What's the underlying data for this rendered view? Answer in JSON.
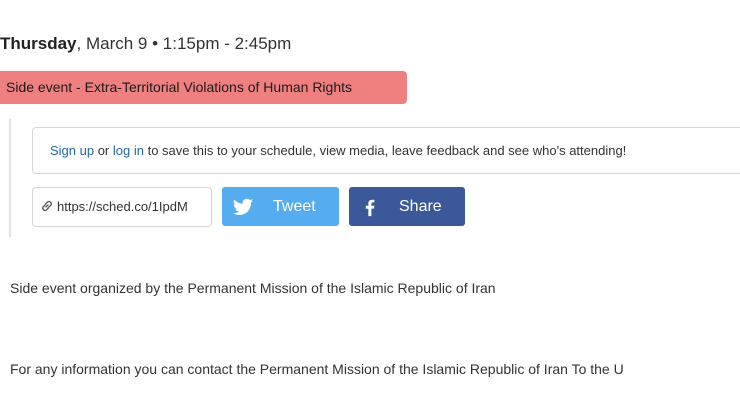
{
  "event": {
    "day": "Thursday",
    "date_time": ", March 9 • 1:15pm - 2:45pm",
    "type_label": "Side event - Extra-Territorial Violations of Human Rights"
  },
  "signup": {
    "signup_link": "Sign up",
    "or_text": " or ",
    "login_link": "log in",
    "rest_text": " to save this to your schedule, view media, leave feedback and see who's attending!"
  },
  "share": {
    "short_url": "https://sched.co/1IpdM",
    "tweet_label": "Tweet",
    "share_label": "Share",
    "icons": {
      "link": "link-icon",
      "twitter": "twitter-bird-icon",
      "facebook": "facebook-f-icon"
    },
    "colors": {
      "tweet": "#55acee",
      "share": "#3b5998",
      "badge": "#f08080"
    }
  },
  "description": {
    "line1": "Side event organized by the Permanent Mission of the Islamic Republic of Iran",
    "line2": "For any information you can contact the Permanent Mission of the Islamic Republic of Iran To the U"
  }
}
